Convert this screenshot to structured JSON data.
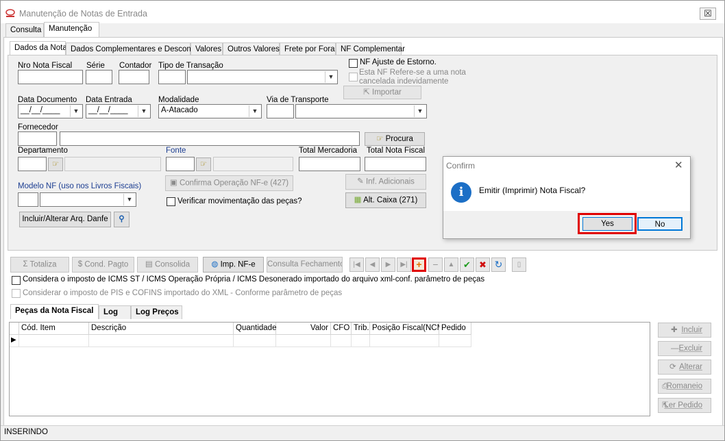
{
  "window": {
    "title": "Manutenção de Notas de Entrada",
    "close": "☒"
  },
  "main_tabs": [
    "Consulta",
    "Manutenção"
  ],
  "sub_tabs": [
    "Dados da Nota",
    "Dados Complementares e Desconto",
    "Valores",
    "Outros Valores",
    "Frete por Fora",
    "NF Complementar"
  ],
  "form": {
    "nro_nota_label": "Nro Nota Fiscal",
    "serie_label": "Série",
    "contador_label": "Contador",
    "tipo_transacao_label": "Tipo de Transação",
    "nf_ajuste_label": "NF Ajuste  de Estorno.",
    "nf_refere_label_1": "Esta NF Refere-se a uma nota",
    "nf_refere_label_2": "cancelada indevidamente",
    "importar_label": "Importar",
    "data_documento_label": "Data Documento",
    "data_documento_value": "__/__/____",
    "data_entrada_label": "Data Entrada",
    "data_entrada_value": "__/__/____",
    "modalidade_label": "Modalidade",
    "modalidade_value": "A-Atacado",
    "via_transporte_label": "Via de Transporte",
    "fornecedor_label": "Fornecedor",
    "procura_label": "Procura",
    "departamento_label": "Departamento",
    "fonte_label": "Fonte",
    "total_mercadoria_label": "Total Mercadoria",
    "total_nota_label": "Total Nota Fiscal",
    "modelo_nf_label": "Modelo NF (uso nos Livros Fiscais)",
    "confirma_operacao_label": "Confirma Operação NF-e (427)",
    "inf_adicionais_label": "Inf. Adicionais",
    "verificar_mov_label": "Verificar movimentação das peças?",
    "alt_caixa_label": "Alt. Caixa (271)",
    "incluir_danfe_label": "Incluir/Alterar Arq. Danfe"
  },
  "toolbar": {
    "totaliza": "Totaliza",
    "cond_pagto": "Cond. Pagto",
    "consolida": "Consolida",
    "imp_nfe": "Imp. NF-e",
    "consulta_fechamento": "Consulta Fechamento"
  },
  "checks": {
    "icms_st": "Considera o imposto de ICMS ST / ICMS Operação Própria / ICMS Desonerado importado do arquivo xml-conf. parâmetro de peças",
    "pis_cofins": "Considerar o imposto de PIS e COFINS importado do XML - Conforme parâmetro de peças"
  },
  "bottom_tabs": [
    "Peças da Nota Fiscal",
    "Log",
    "Log Preços"
  ],
  "grid": {
    "columns": [
      "Cód. Item",
      "Descrição",
      "Quantidade",
      "Valor",
      "CFO",
      "Trib.",
      "Posição Fiscal(NCM)",
      "Pedido"
    ]
  },
  "side_buttons": [
    "Incluir",
    "Excluir",
    "Alterar",
    "Romaneio",
    "Ler Pedido"
  ],
  "status": "INSERINDO",
  "dialog": {
    "title": "Confirm",
    "message": "Emitir (Imprimir) Nota Fiscal?",
    "yes": "Yes",
    "no": "No"
  },
  "colors": {
    "highlight": "#e00000",
    "info_icon": "#1c6fc6",
    "label_blue": "#1b3d91"
  }
}
